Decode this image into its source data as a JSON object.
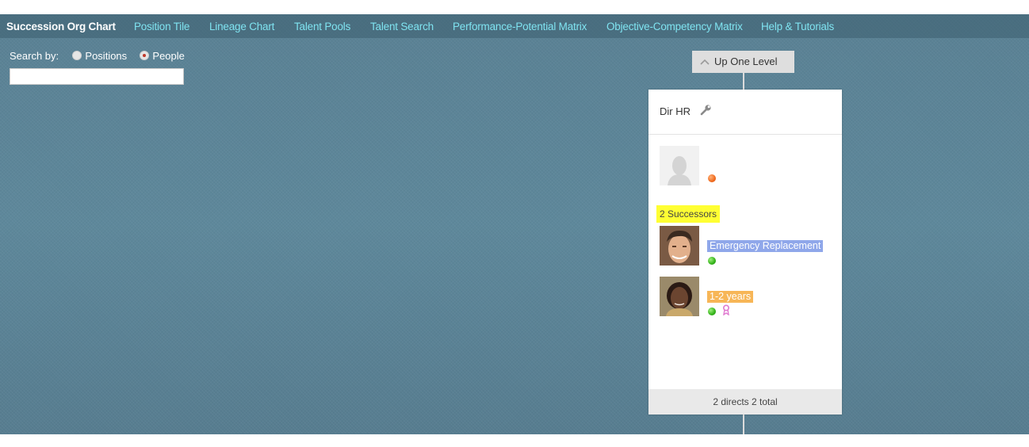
{
  "nav": {
    "items": [
      {
        "label": "Succession Org Chart",
        "active": true
      },
      {
        "label": "Position Tile",
        "active": false
      },
      {
        "label": "Lineage Chart",
        "active": false
      },
      {
        "label": "Talent Pools",
        "active": false
      },
      {
        "label": "Talent Search",
        "active": false
      },
      {
        "label": "Performance-Potential Matrix",
        "active": false
      },
      {
        "label": "Objective-Competency Matrix",
        "active": false
      },
      {
        "label": "Help & Tutorials",
        "active": false
      }
    ]
  },
  "search": {
    "label": "Search by:",
    "options": [
      "Positions",
      "People"
    ],
    "selected": "People",
    "input_value": ""
  },
  "up_level": {
    "label": "Up One Level",
    "icon": "chevron-up-icon"
  },
  "card": {
    "title": "Dir HR",
    "title_icon": "wrench-icon",
    "incumbent": {
      "status_color": "#f06a1e"
    },
    "successors_label": "2 Successors",
    "successors": [
      {
        "readiness": "Emergency Replacement",
        "readiness_color": "#8fa7ea",
        "status_color": "#33b21a"
      },
      {
        "readiness": "1-2 years",
        "readiness_color": "#f7b657",
        "status_color": "#33b21a",
        "ribbon_icon": "ribbon-icon"
      }
    ],
    "footer": "2 directs 2 total"
  },
  "colors": {
    "background": "#5b8396",
    "nav_link": "#7fe3f0",
    "highlight": "#ffff33"
  }
}
